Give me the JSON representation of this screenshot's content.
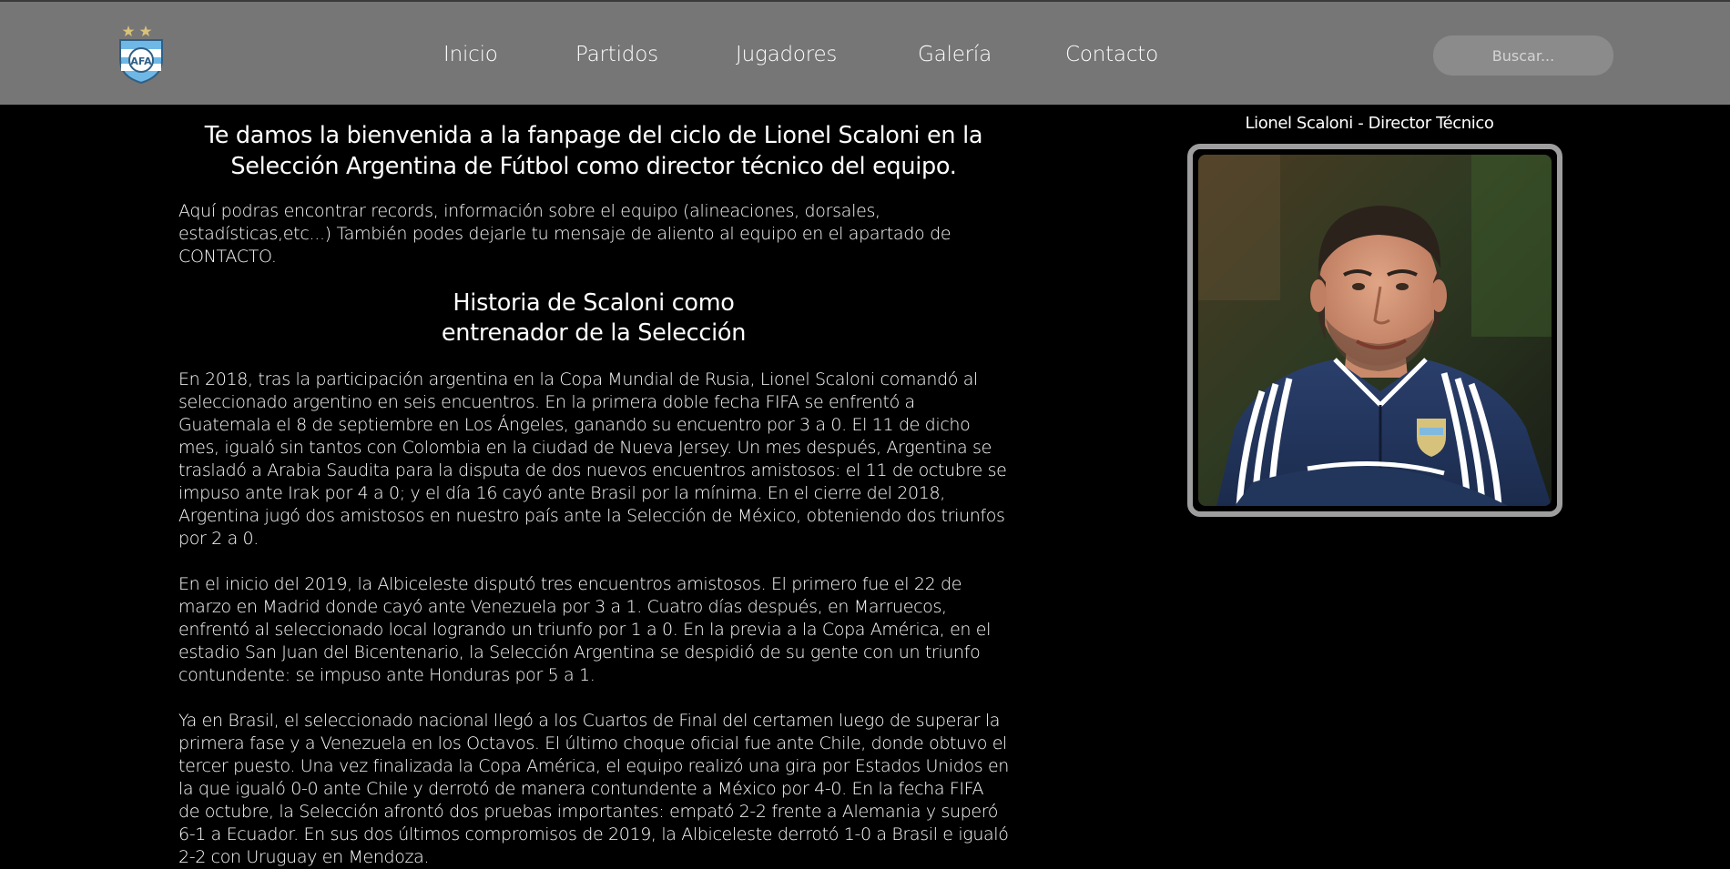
{
  "nav": {
    "items": [
      {
        "label": "Inicio"
      },
      {
        "label": "Partidos"
      },
      {
        "label": "Jugadores"
      },
      {
        "label": "Galería"
      },
      {
        "label": "Contacto"
      }
    ],
    "search_placeholder": "Buscar...",
    "logo_icon": "afa-crest-icon"
  },
  "main": {
    "welcome": "Te damos la bienvenida a la fanpage del ciclo de Lionel Scaloni en la Selección Argentina de Fútbol como director técnico del equipo.",
    "intro": "Aquí podras encontrar records, información sobre el equipo (alineaciones, dorsales, estadísticas,etc...) También podes dejarle tu mensaje de aliento al equipo en el apartado de CONTACTO.",
    "history_title_line1": "Historia de Scaloni como",
    "history_title_line2": "entrenador de la Selección",
    "paragraphs": [
      "En 2018, tras la participación argentina en la Copa Mundial de Rusia, Lionel Scaloni comandó al seleccionado argentino en seis encuentros. En la primera doble fecha FIFA se enfrentó a Guatemala el 8 de septiembre en Los Ángeles, ganando su encuentro por 3 a 0. El 11 de dicho mes, igualó sin tantos con Colombia en la ciudad de Nueva Jersey. Un mes después, Argentina se trasladó a Arabia Saudita para la disputa de dos nuevos encuentros amistosos: el 11 de octubre se impuso ante Irak por 4 a 0; y el día 16 cayó ante Brasil por la mínima. En el cierre del 2018, Argentina jugó dos amistosos en nuestro país ante la Selección de México, obteniendo dos triunfos por 2 a 0.",
      "En el inicio del 2019, la Albiceleste disputó tres encuentros amistosos. El primero fue el 22 de marzo en Madrid donde cayó ante Venezuela por 3 a 1. Cuatro días después, en Marruecos, enfrentó al seleccionado local logrando un triunfo por 1 a 0. En la previa a la Copa América, en el estadio San Juan del Bicentenario, la Selección Argentina se despidió de su gente con un triunfo contundente: se impuso ante Honduras por 5 a 1.",
      "Ya en Brasil, el seleccionado nacional llegó a los Cuartos de Final del certamen luego de superar la primera fase y a Venezuela en los Octavos. El último choque oficial fue ante Chile, donde obtuvo el tercer puesto. Una vez finalizada la Copa América, el equipo realizó una gira por Estados Unidos en la que igualó 0-0 ante Chile y derrotó de manera contundente a México por 4-0. En la fecha FIFA de octubre, la Selección afrontó dos pruebas importantes: empató 2-2 frente a Alemania y superó 6-1 a Ecuador. En sus dos últimos compromisos de 2019, la Albiceleste derrotó 1-0 a Brasil e igualó 2-2 con Uruguay en Mendoza."
    ]
  },
  "sidebar": {
    "caption": "Lionel Scaloni - Director Técnico"
  },
  "colors": {
    "navbar": "#767676",
    "background": "#000000",
    "text": "#ffffff",
    "frame": "#9e9e9e"
  }
}
